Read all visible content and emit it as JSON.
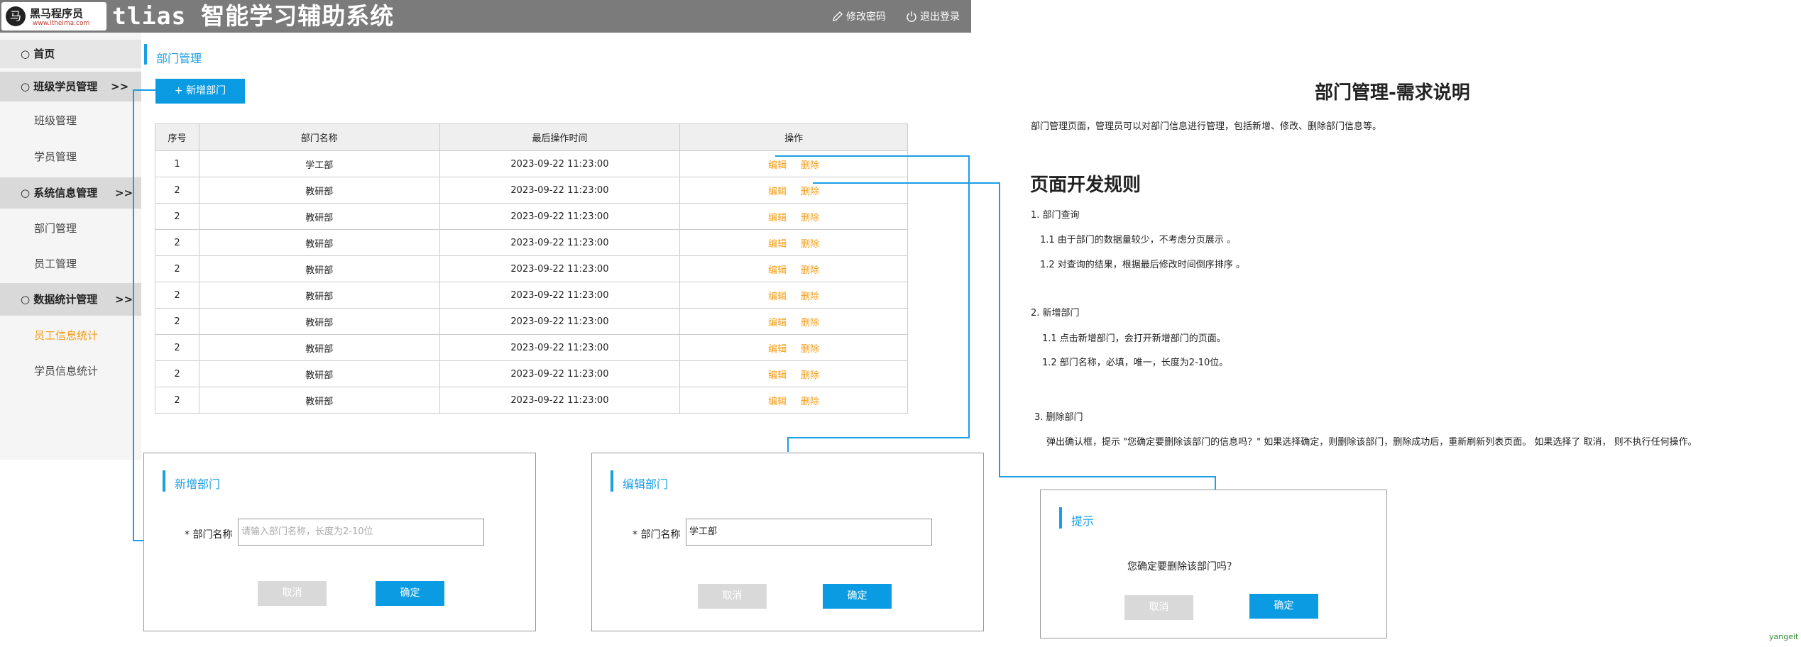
{
  "header": {
    "logo_mark": "马",
    "logo_name": "黑马程序员",
    "logo_url": "www.itheima.com",
    "app_title": "tlias 智能学习辅助系统",
    "change_password": "修改密码",
    "logout": "退出登录"
  },
  "sidebar": {
    "home": "○ 首页",
    "group_class": "○ 班级学员管理",
    "group_class_arrow": ">>",
    "class_mgmt": "班级管理",
    "student_mgmt": "学员管理",
    "group_system": "○ 系统信息管理",
    "group_system_arrow": ">>",
    "dept_mgmt": "部门管理",
    "emp_mgmt": "员工管理",
    "group_stats": "○ 数据统计管理",
    "group_stats_arrow": ">>",
    "emp_stats": "员工信息统计",
    "student_stats": "学员信息统计"
  },
  "main": {
    "page_title": "部门管理",
    "add_button": "+ 新增部门",
    "table": {
      "headers": [
        "序号",
        "部门名称",
        "最后操作时间",
        "操作"
      ],
      "edit_label": "编辑",
      "delete_label": "删除",
      "rows": [
        [
          "1",
          "学工部",
          "2023-09-22 11:23:00"
        ],
        [
          "2",
          "教研部",
          "2023-09-22 11:23:00"
        ],
        [
          "2",
          "教研部",
          "2023-09-22 11:23:00"
        ],
        [
          "2",
          "教研部",
          "2023-09-22 11:23:00"
        ],
        [
          "2",
          "教研部",
          "2023-09-22 11:23:00"
        ],
        [
          "2",
          "教研部",
          "2023-09-22 11:23:00"
        ],
        [
          "2",
          "教研部",
          "2023-09-22 11:23:00"
        ],
        [
          "2",
          "教研部",
          "2023-09-22 11:23:00"
        ],
        [
          "2",
          "教研部",
          "2023-09-22 11:23:00"
        ],
        [
          "2",
          "教研部",
          "2023-09-22 11:23:00"
        ]
      ]
    }
  },
  "add_dialog": {
    "title": "新增部门",
    "label": "* 部门名称",
    "placeholder": "请输入部门名称，长度为2-10位",
    "cancel": "取消",
    "ok": "确定"
  },
  "edit_dialog": {
    "title": "编辑部门",
    "label": "* 部门名称",
    "value": "学工部",
    "cancel": "取消",
    "ok": "确定"
  },
  "confirm_dialog": {
    "title": "提示",
    "message": "您确定要删除该部门吗？",
    "cancel": "取消",
    "ok": "确定"
  },
  "doc": {
    "title": "部门管理-需求说明",
    "intro": "部门管理页面，管理员可以对部门信息进行管理，包括新增、修改、删除部门信息等。",
    "rules_title": "页面开发规则",
    "s1": "1. 部门查询",
    "s1_1": "1.1  由于部门的数据量较少，不考虑分页展示 。",
    "s1_2": "1.2  对查询的结果，根据最后修改时间倒序排序 。",
    "s2": "2. 新增部门",
    "s2_1": "1.1 点击新增部门，会打开新增部门的页面。",
    "s2_2": "1.2 部门名称，必填，唯一，长度为2-10位。",
    "s3": "3.  删除部门",
    "s3_1": "弹出确认框，提示 \"您确定要删除该部门的信息吗？\" 如果选择确定，则删除该部门，删除成功后，重新刷新列表页面。 如果选择了 取消， 则不执行任何操作。"
  },
  "watermark": "yangeit",
  "colors": {
    "accent": "#0a9be3",
    "action": "#f39c12",
    "header_bg": "#7b7b7b"
  }
}
